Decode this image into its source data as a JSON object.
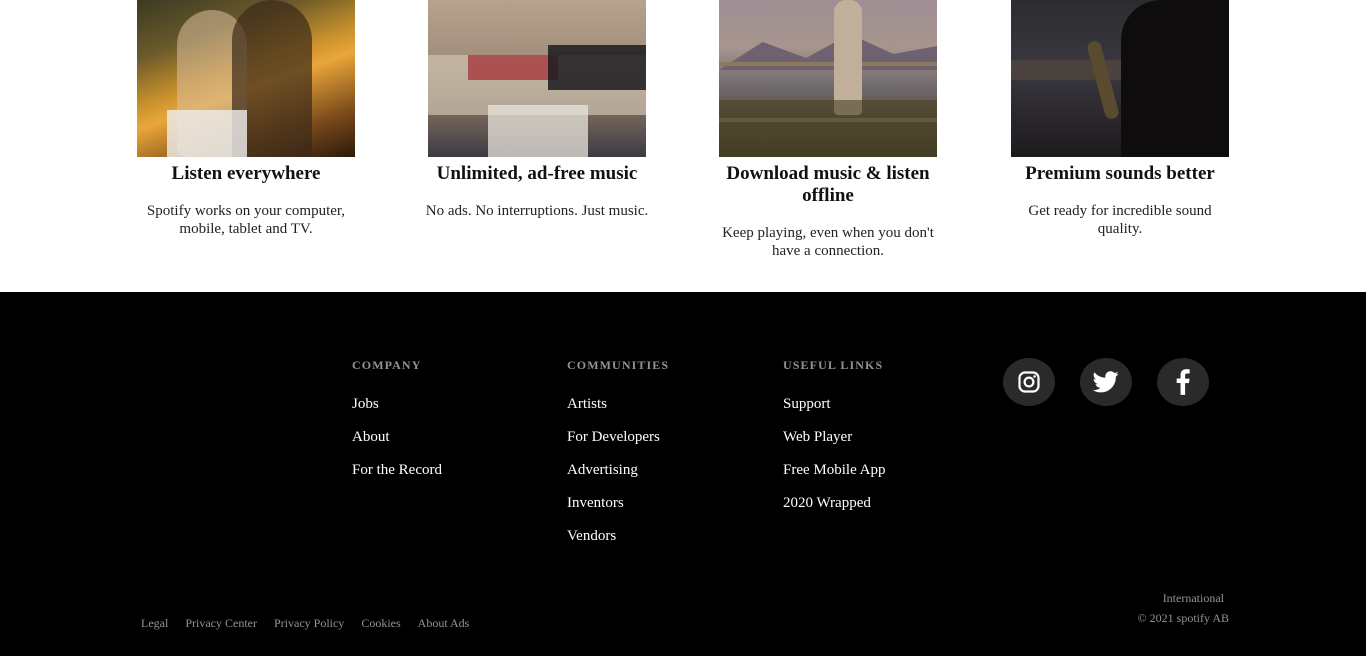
{
  "features": [
    {
      "title": "Listen everywhere",
      "text": "Spotify works on your computer, mobile, tablet and TV."
    },
    {
      "title": "Unlimited, ad-free music",
      "text": "No ads. No interruptions. Just music."
    },
    {
      "title": "Download music & listen offline",
      "text": "Keep playing, even when you don't have a connection."
    },
    {
      "title": "Premium sounds better",
      "text": "Get ready for incredible sound quality."
    }
  ],
  "footer": {
    "columns": [
      {
        "title": "COMPANY",
        "links": [
          "Jobs",
          "About",
          "For the Record"
        ]
      },
      {
        "title": "COMMUNITIES",
        "links": [
          "Artists",
          "For Developers",
          "Advertising",
          "Inventors",
          "Vendors"
        ]
      },
      {
        "title": "USEFUL LINKS",
        "links": [
          "Support",
          "Web Player",
          "Free Mobile App",
          "2020 Wrapped"
        ]
      }
    ],
    "social": [
      "instagram-icon",
      "twitter-icon",
      "facebook-icon"
    ],
    "legal_links": [
      "Legal",
      "Privacy Center",
      "Privacy Policy",
      "Cookies",
      "About Ads"
    ],
    "region": "International",
    "copyright": "© 2021 spotify AB"
  },
  "colors": {
    "footer_bg": "#000000",
    "footer_muted": "#919496",
    "social_bg": "#2a2a2a"
  }
}
